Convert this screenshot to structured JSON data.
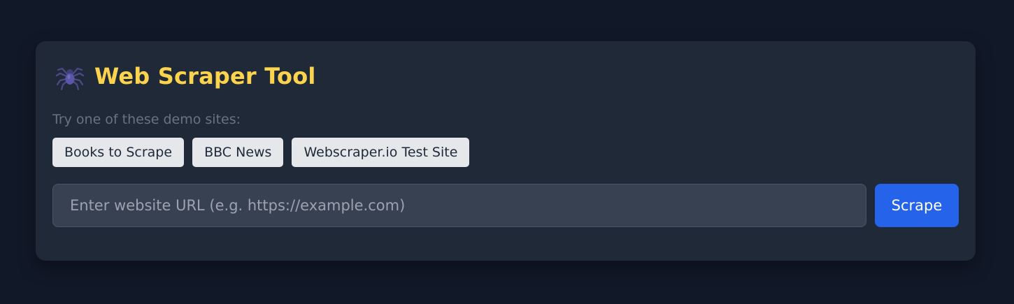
{
  "app": {
    "title": "Web Scraper Tool",
    "icon": "spider-icon"
  },
  "demo": {
    "hint": "Try one of these demo sites:",
    "sites": [
      {
        "label": "Books to Scrape"
      },
      {
        "label": "BBC News"
      },
      {
        "label": "Webscraper.io Test Site"
      }
    ]
  },
  "form": {
    "url_value": "",
    "url_placeholder": "Enter website URL (e.g. https://example.com)",
    "submit_label": "Scrape"
  },
  "colors": {
    "background": "#111827",
    "card": "#1f2937",
    "title": "#fcd34d",
    "accent": "#2563eb"
  }
}
